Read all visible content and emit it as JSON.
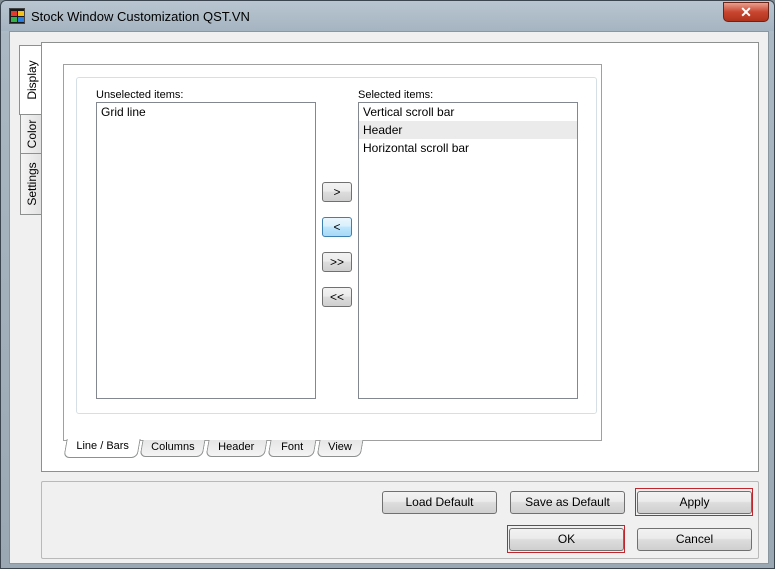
{
  "window": {
    "title": "Stock Window Customization QST.VN",
    "close_glyph": "✕"
  },
  "side_tabs": [
    {
      "label": "Display",
      "active": true
    },
    {
      "label": "Color",
      "active": false
    },
    {
      "label": "Settings",
      "active": false
    }
  ],
  "unselected": {
    "label": "Unselected items:",
    "items": [
      "Grid line"
    ]
  },
  "selected": {
    "label": "Selected items:",
    "items": [
      "Vertical scroll bar",
      "Header",
      "Horizontal scroll bar"
    ],
    "hovered_item": "Header"
  },
  "move_buttons": {
    "add": ">",
    "remove": "<",
    "add_all": ">>",
    "remove_all": "<<"
  },
  "bottom_tabs": [
    {
      "label": "Line / Bars",
      "active": true
    },
    {
      "label": "Columns",
      "active": false
    },
    {
      "label": "Header",
      "active": false
    },
    {
      "label": "Font",
      "active": false
    },
    {
      "label": "View",
      "active": false
    }
  ],
  "footer": {
    "load_default": "Load Default",
    "save_as_default": "Save as Default",
    "apply": "Apply",
    "ok": "OK",
    "cancel": "Cancel"
  },
  "colors": {
    "highlight_outline": "#c0262c",
    "focus_button": "#3c7fb1"
  }
}
